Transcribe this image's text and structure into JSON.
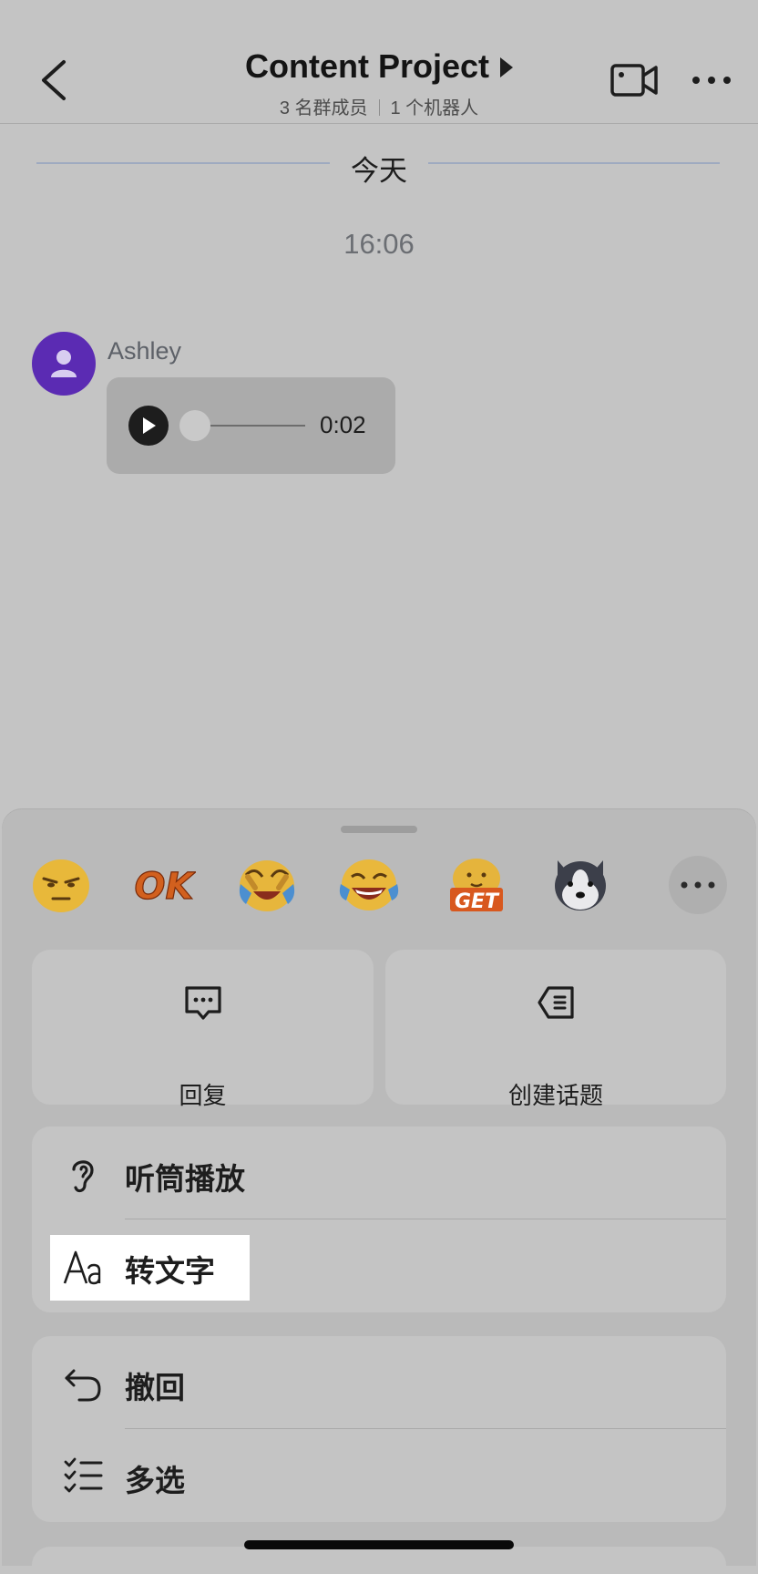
{
  "header": {
    "title": "Content Project",
    "members": "3 名群成员",
    "bots": "1 个机器人"
  },
  "chat": {
    "date_divider": "今天",
    "time": "16:06",
    "message": {
      "sender": "Ashley",
      "voice_duration": "0:02"
    }
  },
  "reactions": [
    "grumpy-face-emoji",
    "ok-sticker",
    "crying-laughing-emoji",
    "tears-of-joy-emoji",
    "get-sticker",
    "husky-dog-emoji"
  ],
  "actions": {
    "reply": "回复",
    "create_topic": "创建话题",
    "earpiece": "听筒播放",
    "to_text": "转文字",
    "recall": "撤回",
    "multi_select": "多选"
  },
  "colors": {
    "avatar": "#5b2bb3",
    "highlight": "#ffffff",
    "overlay_gray": "#c4c4c4"
  }
}
